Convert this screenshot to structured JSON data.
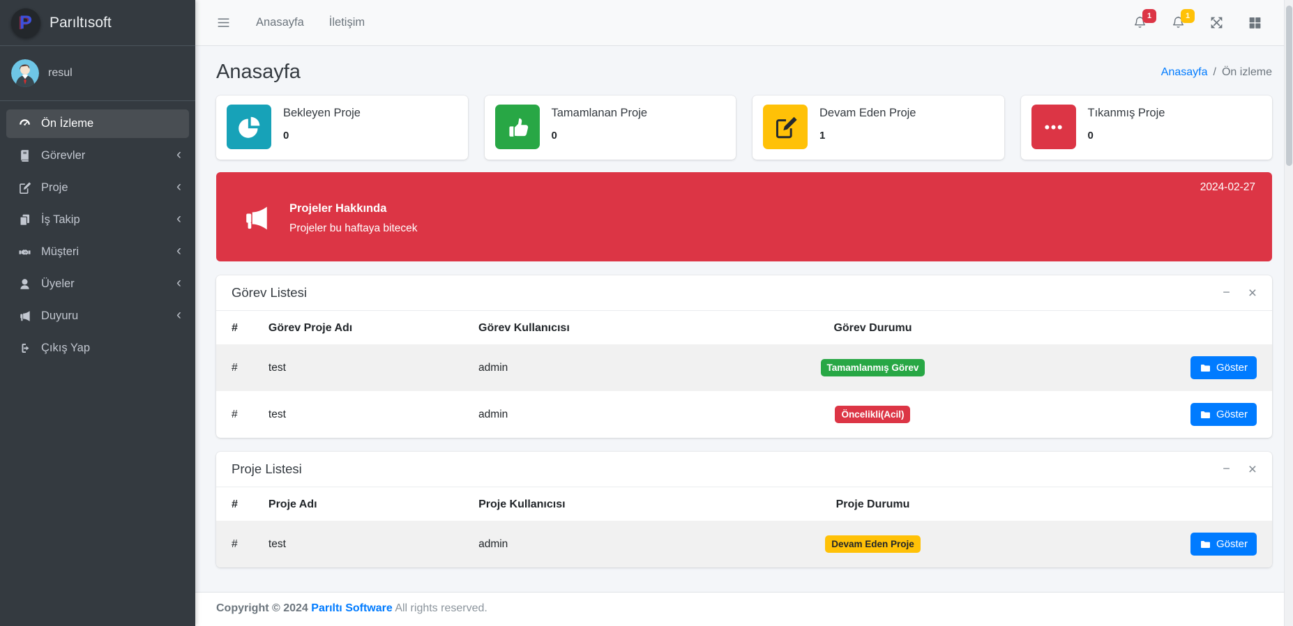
{
  "brand": {
    "name": "Parıltısoft",
    "logo_letter": "P"
  },
  "user": {
    "name": "resul"
  },
  "sidebar": {
    "items": [
      {
        "label": "Ön İzleme",
        "icon": "gauge-icon",
        "active": true
      },
      {
        "label": "Görevler",
        "icon": "book-icon",
        "chevron": true
      },
      {
        "label": "Proje",
        "icon": "edit-icon",
        "chevron": true
      },
      {
        "label": "İş Takip",
        "icon": "copy-icon",
        "chevron": true
      },
      {
        "label": "Müşteri",
        "icon": "handshake-icon",
        "chevron": true
      },
      {
        "label": "Üyeler",
        "icon": "user-icon",
        "chevron": true
      },
      {
        "label": "Duyuru",
        "icon": "bullhorn-icon",
        "chevron": true
      },
      {
        "label": "Çıkış Yap",
        "icon": "sign-out-icon",
        "chevron": false
      }
    ]
  },
  "navbar": {
    "links": [
      {
        "label": "Anasayfa"
      },
      {
        "label": "İletişim"
      }
    ],
    "notifications": [
      {
        "icon": "bell-icon",
        "count": "1",
        "color": "#dc3545"
      },
      {
        "icon": "bell-icon",
        "count": "1",
        "color": "#ffc107"
      }
    ]
  },
  "page": {
    "title": "Anasayfa",
    "breadcrumb": {
      "link": "Anasayfa",
      "separator": "/",
      "current": "Ön izleme"
    }
  },
  "stats": [
    {
      "label": "Bekleyen Proje",
      "value": "0",
      "color": "#17a2b8",
      "icon": "pie-chart-icon"
    },
    {
      "label": "Tamamlanan Proje",
      "value": "0",
      "color": "#28a745",
      "icon": "thumbs-up-icon"
    },
    {
      "label": "Devam Eden Proje",
      "value": "1",
      "color": "#ffc107",
      "icon": "edit-icon"
    },
    {
      "label": "Tıkanmış Proje",
      "value": "0",
      "color": "#dc3545",
      "icon": "ellipsis-icon"
    }
  ],
  "announcement": {
    "date": "2024-02-27",
    "title": "Projeler Hakkında",
    "message": "Projeler bu haftaya bitecek",
    "color": "#dc3545",
    "icon": "bullhorn-icon"
  },
  "task_panel": {
    "title": "Görev Listesi",
    "headers": {
      "num": "#",
      "name": "Görev Proje Adı",
      "user": "Görev Kullanıcısı",
      "status": "Görev Durumu"
    },
    "rows": [
      {
        "num": "#",
        "name": "test",
        "user": "admin",
        "status": "Tamamlanmış Görev",
        "status_color": "#28a745",
        "action": "Göster"
      },
      {
        "num": "#",
        "name": "test",
        "user": "admin",
        "status": "Öncelikli(Acil)",
        "status_color": "#dc3545",
        "action": "Göster"
      }
    ]
  },
  "project_panel": {
    "title": "Proje Listesi",
    "headers": {
      "num": "#",
      "name": "Proje Adı",
      "user": "Proje Kullanıcısı",
      "status": "Proje Durumu"
    },
    "rows": [
      {
        "num": "#",
        "name": "test",
        "user": "admin",
        "status": "Devam Eden Proje",
        "status_color": "#ffc107",
        "action": "Göster"
      }
    ]
  },
  "footer": {
    "copyright": "Copyright © 2024",
    "brand_link": "Parıltı Software",
    "rights": "All rights reserved."
  }
}
